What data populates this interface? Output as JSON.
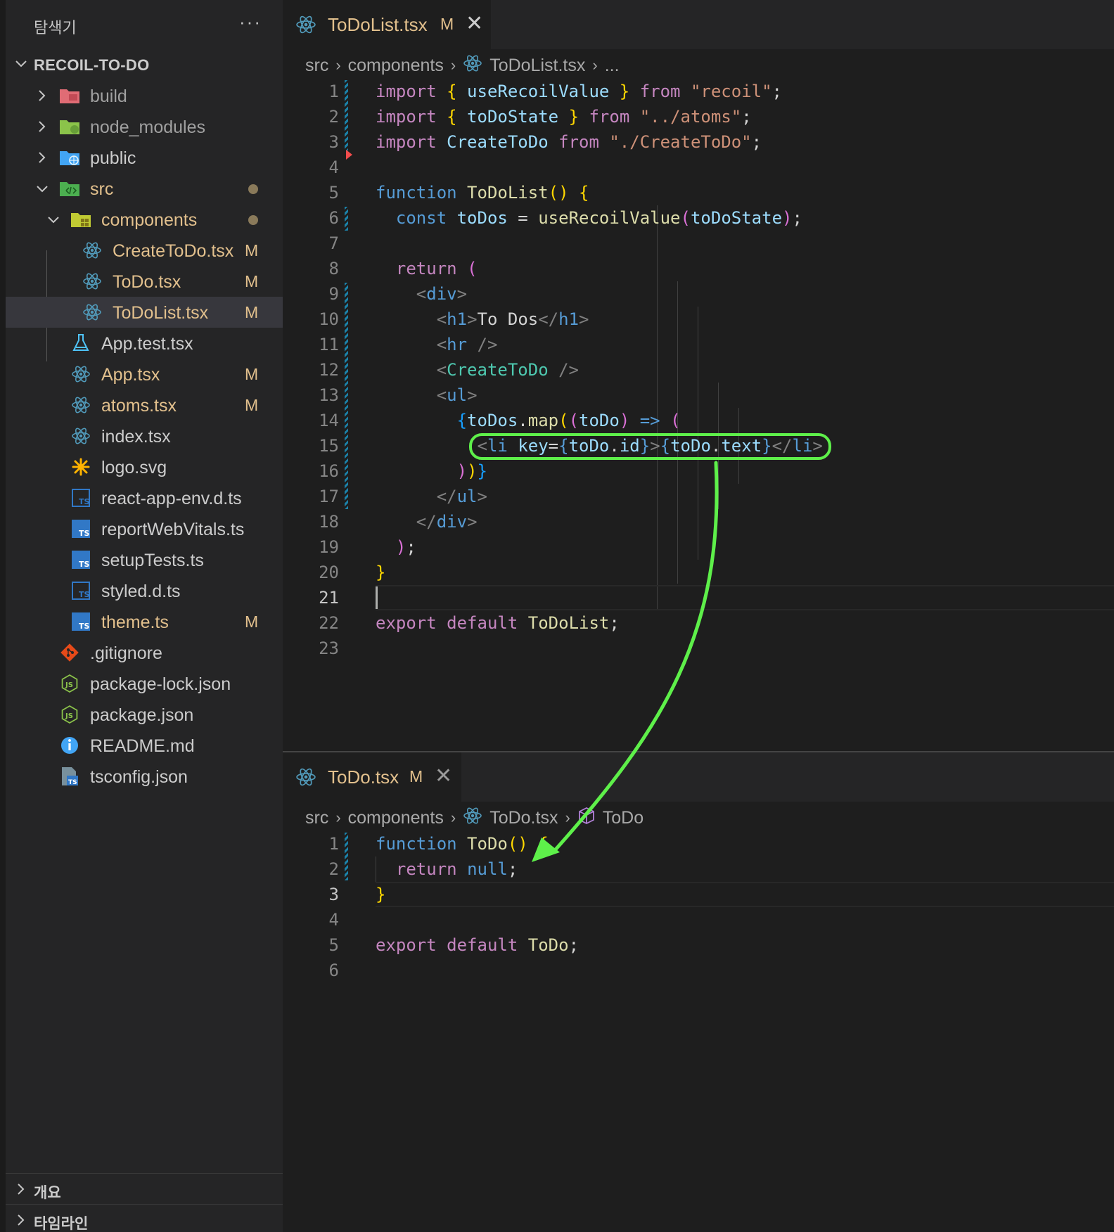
{
  "explorer": {
    "title": "탐색기",
    "more": "···",
    "root": "RECOIL-TO-DO",
    "items": [
      {
        "label": "build",
        "icon": "folder-build-icon"
      },
      {
        "label": "node_modules",
        "icon": "folder-node-icon"
      },
      {
        "label": "public",
        "icon": "folder-public-icon"
      },
      {
        "label": "src",
        "icon": "folder-src-icon"
      },
      {
        "label": "components",
        "icon": "folder-components-icon"
      },
      {
        "label": "CreateToDo.tsx",
        "badge": "M",
        "icon": "react-icon"
      },
      {
        "label": "ToDo.tsx",
        "badge": "M",
        "icon": "react-icon"
      },
      {
        "label": "ToDoList.tsx",
        "badge": "M",
        "icon": "react-icon"
      },
      {
        "label": "App.test.tsx",
        "icon": "test-flask-icon"
      },
      {
        "label": "App.tsx",
        "badge": "M",
        "icon": "react-icon"
      },
      {
        "label": "atoms.tsx",
        "badge": "M",
        "icon": "react-icon"
      },
      {
        "label": "index.tsx",
        "icon": "react-icon"
      },
      {
        "label": "logo.svg",
        "icon": "svg-asterisk-icon"
      },
      {
        "label": "react-app-env.d.ts",
        "icon": "ts-definition-icon"
      },
      {
        "label": "reportWebVitals.ts",
        "icon": "ts-icon"
      },
      {
        "label": "setupTests.ts",
        "icon": "ts-icon"
      },
      {
        "label": "styled.d.ts",
        "icon": "ts-definition-icon"
      },
      {
        "label": "theme.ts",
        "badge": "M",
        "icon": "ts-icon"
      },
      {
        "label": ".gitignore",
        "icon": "git-icon"
      },
      {
        "label": "package-lock.json",
        "icon": "nodejs-icon"
      },
      {
        "label": "package.json",
        "icon": "nodejs-icon"
      },
      {
        "label": "README.md",
        "icon": "info-icon"
      },
      {
        "label": "tsconfig.json",
        "icon": "tsconfig-icon"
      }
    ],
    "outline": "개요",
    "timeline": "타임라인"
  },
  "editor_top": {
    "tab": {
      "name": "ToDoList.tsx",
      "badge": "M",
      "close": "✕"
    },
    "breadcrumb": {
      "p1": "src",
      "p2": "components",
      "p3": "ToDoList.tsx",
      "p4": "..."
    },
    "line_numbers": [
      "1",
      "2",
      "3",
      "4",
      "5",
      "6",
      "7",
      "8",
      "9",
      "10",
      "11",
      "12",
      "13",
      "14",
      "15",
      "16",
      "17",
      "18",
      "19",
      "20",
      "21",
      "22",
      "23"
    ],
    "code": {
      "l1": [
        "import",
        " ",
        "{",
        " useRecoilValue ",
        "}",
        " from ",
        "\"recoil\"",
        ";"
      ],
      "l2": [
        "import",
        " ",
        "{",
        " toDoState ",
        "}",
        " from ",
        "\"../atoms\"",
        ";"
      ],
      "l3": [
        "import",
        " CreateToDo ",
        "from",
        " ",
        "\"./CreateToDo\"",
        ";"
      ],
      "l5": [
        "function",
        " ",
        "ToDoList",
        "()",
        " ",
        "{"
      ],
      "l6": [
        "  ",
        "const",
        " ",
        "toDos",
        " = ",
        "useRecoilValue",
        "(",
        "toDoState",
        ")",
        ";"
      ],
      "l8": [
        "  ",
        "return",
        " ",
        "("
      ],
      "l9": [
        "    ",
        "<",
        "div",
        ">"
      ],
      "l10": [
        "      ",
        "<",
        "h1",
        ">",
        "To Dos",
        "</",
        "h1",
        ">"
      ],
      "l11": [
        "      ",
        "<",
        "hr",
        " />"
      ],
      "l12": [
        "      ",
        "<",
        "CreateToDo",
        " />"
      ],
      "l13": [
        "      ",
        "<",
        "ul",
        ">"
      ],
      "l14": [
        "        ",
        "{",
        "toDos",
        ".",
        "map",
        "(",
        "(",
        "toDo",
        ")",
        " ",
        "=>",
        " ",
        "("
      ],
      "l15": [
        "          ",
        "<",
        "li",
        " ",
        "key",
        "=",
        "{",
        "toDo",
        ".",
        "id",
        "}",
        ">",
        "{",
        "toDo",
        ".",
        "text",
        "}",
        "</",
        "li",
        ">"
      ],
      "l16": [
        "        ",
        ")",
        ")",
        "}"
      ],
      "l17": [
        "      ",
        "</",
        "ul",
        ">"
      ],
      "l18": [
        "    ",
        "</",
        "div",
        ">"
      ],
      "l19": [
        "  ",
        ")",
        ";"
      ],
      "l20": [
        "}"
      ],
      "l22": [
        "export",
        " ",
        "default",
        " ",
        "ToDoList",
        ";"
      ]
    }
  },
  "editor_bottom": {
    "tab": {
      "name": "ToDo.tsx",
      "badge": "M",
      "close": "✕"
    },
    "breadcrumb": {
      "p1": "src",
      "p2": "components",
      "p3": "ToDo.tsx",
      "p4": "ToDo"
    },
    "line_numbers": [
      "1",
      "2",
      "3",
      "4",
      "5",
      "6"
    ],
    "code": {
      "l1": [
        "function",
        " ",
        "ToDo",
        "()",
        " ",
        "{"
      ],
      "l2": [
        "  ",
        "return",
        " ",
        "null",
        ";"
      ],
      "l3": [
        "}"
      ],
      "l5": [
        "export",
        " ",
        "default",
        " ",
        "ToDo",
        ";"
      ]
    }
  },
  "colors": {
    "annotation": "#5ef04a",
    "modified": "#e2c08d",
    "react": "#519aba"
  }
}
